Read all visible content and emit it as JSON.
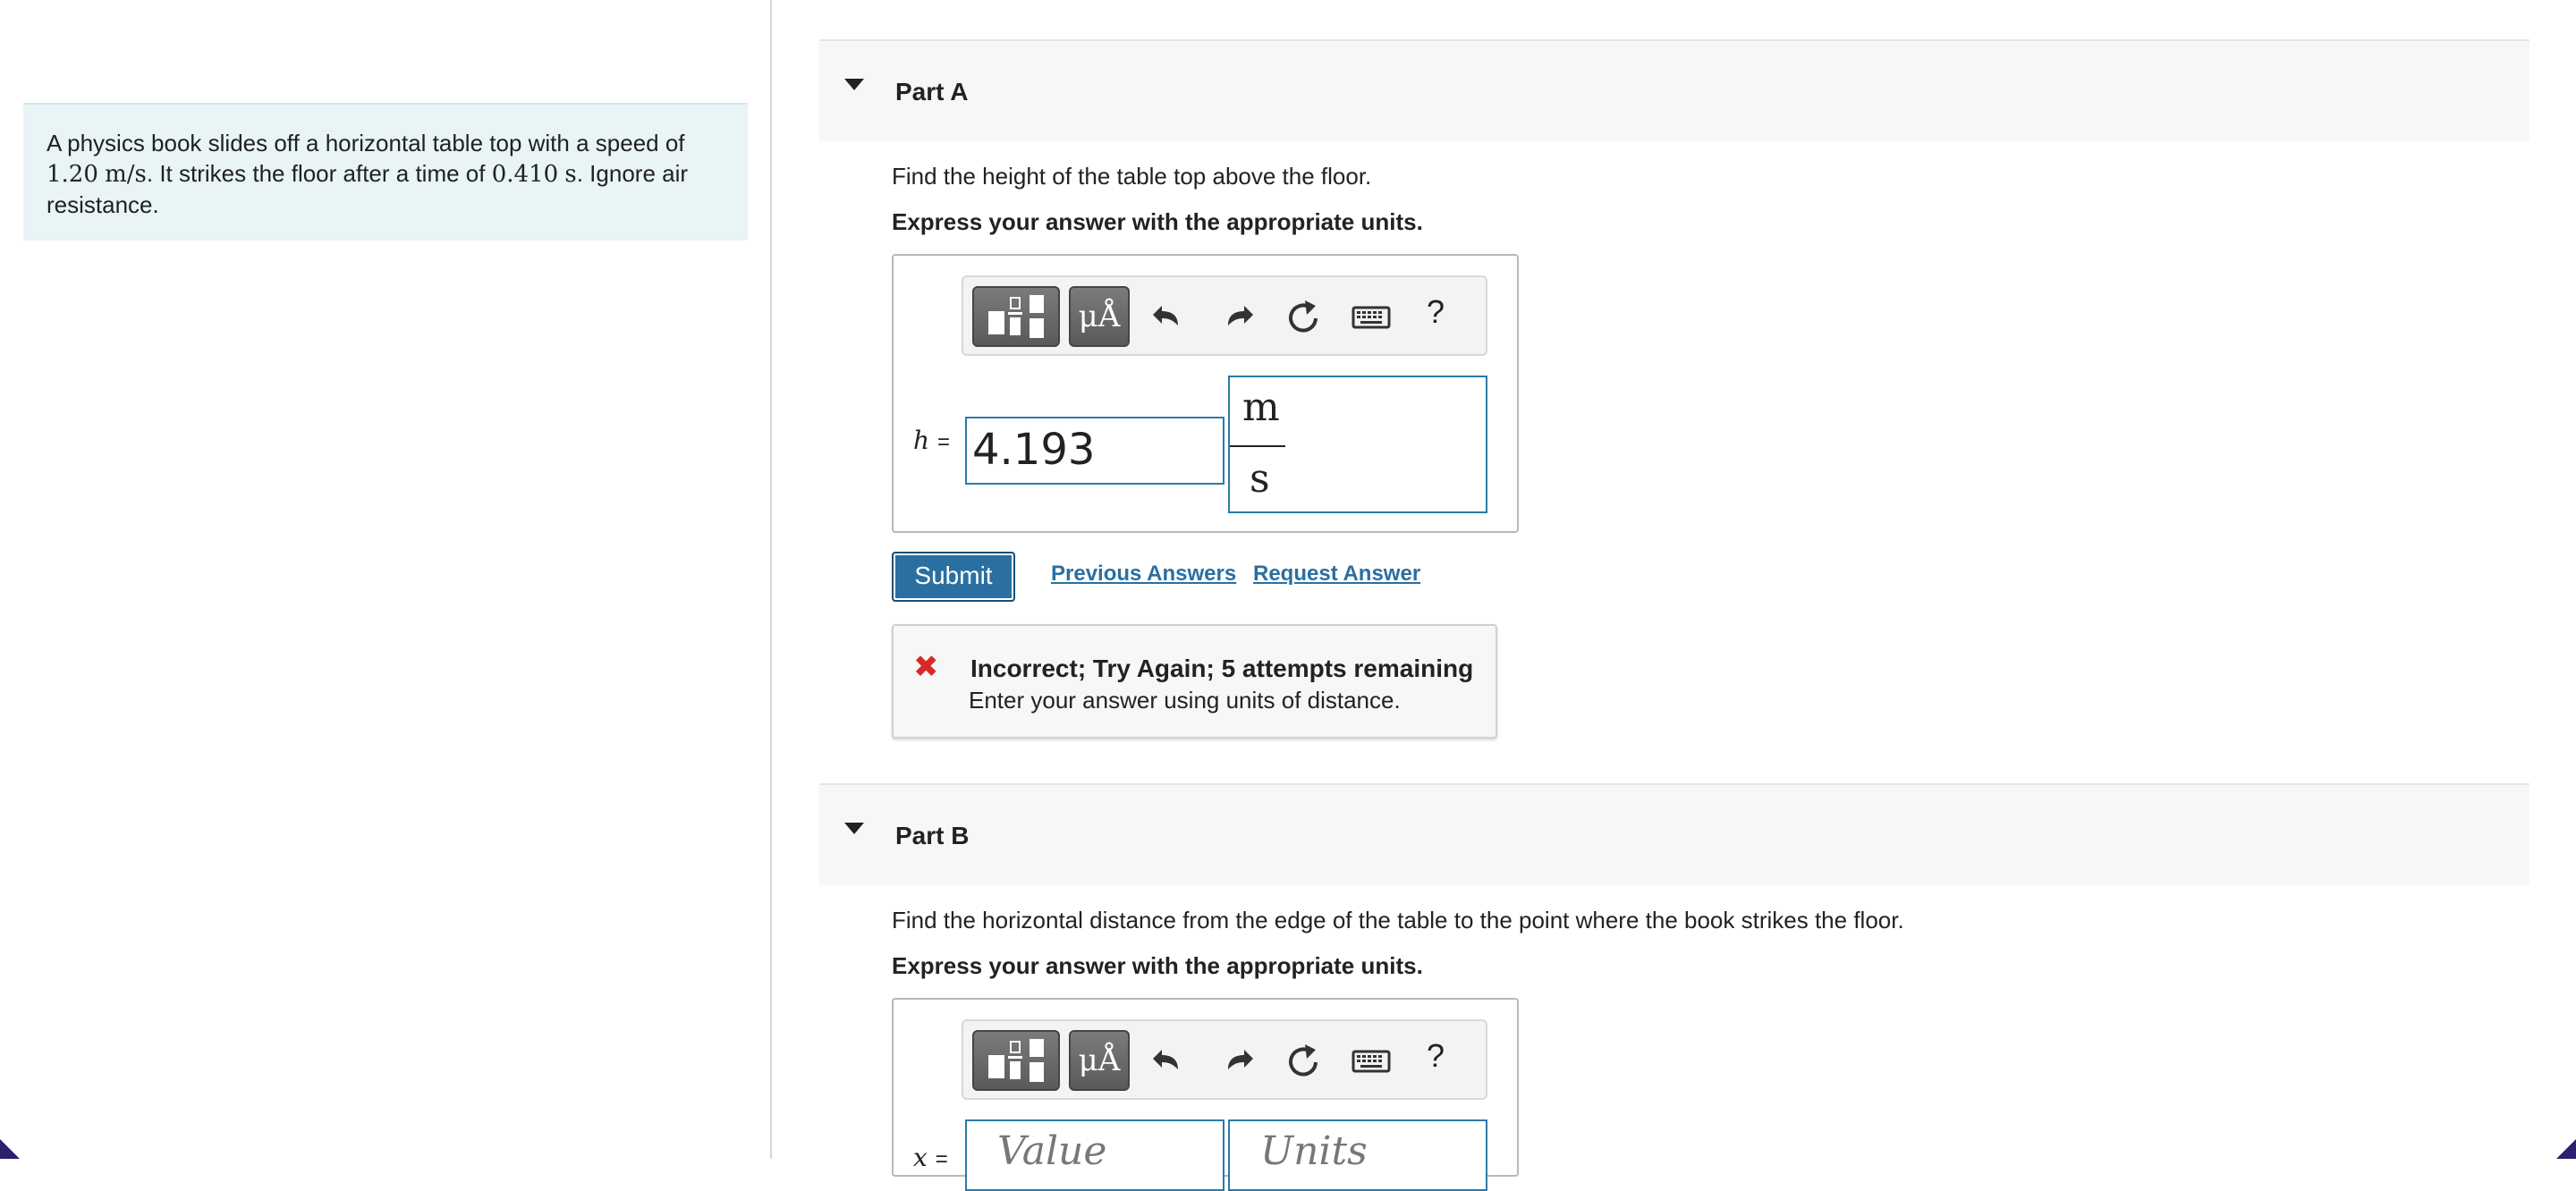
{
  "problem": {
    "text_1": "A physics book slides off a horizontal table top with a speed of",
    "speed_value": "1.20",
    "speed_unit": "m/s",
    "text_2": ". It strikes the floor after a time of",
    "time_value": "0.410",
    "time_unit": "s",
    "text_3": ". Ignore air resistance."
  },
  "toolbar": {
    "units_label": "μÅ",
    "help_label": "?",
    "icons": [
      "templates-icon",
      "units-icon",
      "undo-icon",
      "redo-icon",
      "reset-icon",
      "keyboard-icon",
      "help-icon"
    ]
  },
  "part_a": {
    "title": "Part A",
    "question": "Find the height of the table top above the floor.",
    "instruction": "Express your answer with the appropriate units.",
    "variable": "h",
    "equals": "=",
    "value": "4.193",
    "unit_numerator": "m",
    "unit_denominator": "s",
    "submit_label": "Submit",
    "previous_answers_label": "Previous Answers",
    "request_answer_label": "Request Answer",
    "feedback": {
      "icon": "✖",
      "title": "Incorrect; Try Again; 5 attempts remaining",
      "message": "Enter your answer using units of distance.",
      "status_color": "#d62a2a"
    }
  },
  "part_b": {
    "title": "Part B",
    "question": "Find the horizontal distance from the edge of the table to the point where the book strikes the floor.",
    "instruction": "Express your answer with the appropriate units.",
    "variable": "x",
    "equals": "=",
    "value_placeholder": "Value",
    "units_placeholder": "Units"
  },
  "colors": {
    "accent": "#2a6fa1",
    "problem_bg": "#e8f4f6",
    "header_bg": "#f7f7f7",
    "error": "#d62a2a"
  }
}
